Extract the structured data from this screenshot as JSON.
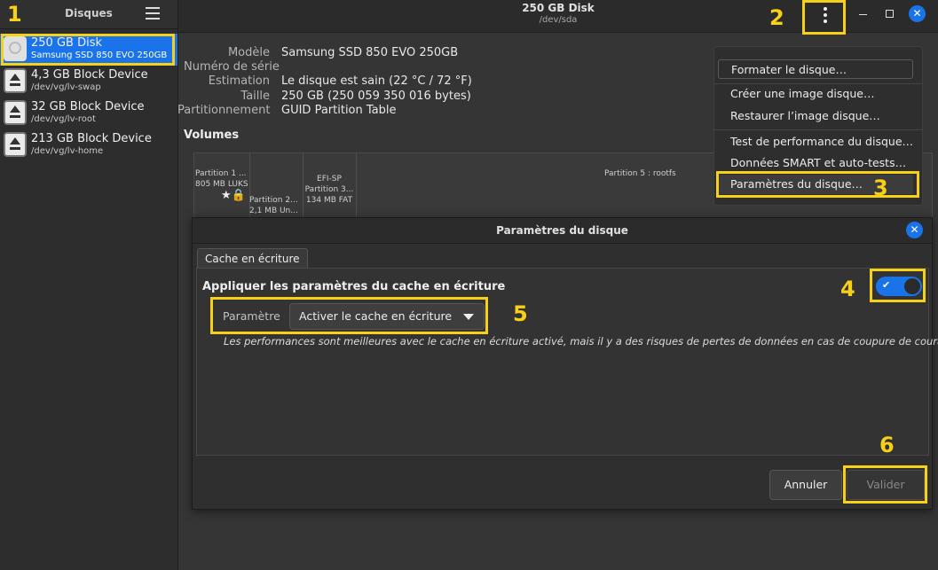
{
  "sidebar": {
    "title": "Disques",
    "items": [
      {
        "name": "250 GB Disk",
        "sub": "Samsung SSD 850 EVO 250GB"
      },
      {
        "name": "4,3 GB Block Device",
        "sub": "/dev/vg/lv-swap"
      },
      {
        "name": "32 GB Block Device",
        "sub": "/dev/vg/lv-root"
      },
      {
        "name": "213 GB Block Device",
        "sub": "/dev/vg/lv-home"
      }
    ]
  },
  "header": {
    "title": "250 GB Disk",
    "subtitle": "/dev/sda"
  },
  "info": {
    "model_label": "Modèle",
    "model": "Samsung SSD 850 EVO 250GB",
    "serial_label": "Numéro de série",
    "estimate_label": "Estimation",
    "estimate": "Le disque est sain (22 °C / 72 °F)",
    "size_label": "Taille",
    "size": "250 GB (250 059 350 016 bytes)",
    "partitioning_label": "Partitionnement",
    "partitioning": "GUID Partition Table"
  },
  "volumes": {
    "title": "Volumes",
    "p1_line1": "Partition 1 ...",
    "p1_line2": "805 MB LUKS",
    "p2_line1": "Partition 2...",
    "p2_line2": "2,1 MB Un...",
    "p3_line1": "EFI-SP",
    "p3_line2": "Partition 3...",
    "p3_line3": "134 MB FAT",
    "p5": "Partition 5 : rootfs"
  },
  "menu": {
    "items": [
      "Formater le disque…",
      "Créer une image disque…",
      "Restaurer l’image disque…",
      "Test de performance du disque…",
      "Données SMART et auto-tests…",
      "Paramètres du disque…"
    ]
  },
  "dialog": {
    "title": "Paramètres du disque",
    "tab": "Cache en écriture",
    "section_title": "Appliquer les paramètres du cache en écriture",
    "param_label": "Paramètre",
    "param_value": "Activer le cache en écriture",
    "description": "Les performances sont meilleures avec le cache en écriture activé, mais il y a des risques de pertes de données en cas de coupure de courant",
    "toggle_on": true,
    "cancel": "Annuler",
    "validate": "Valider"
  },
  "annotations": [
    "1",
    "2",
    "3",
    "4",
    "5",
    "6"
  ],
  "colors": {
    "accent": "#1a73e8",
    "highlight": "#f7d117"
  }
}
